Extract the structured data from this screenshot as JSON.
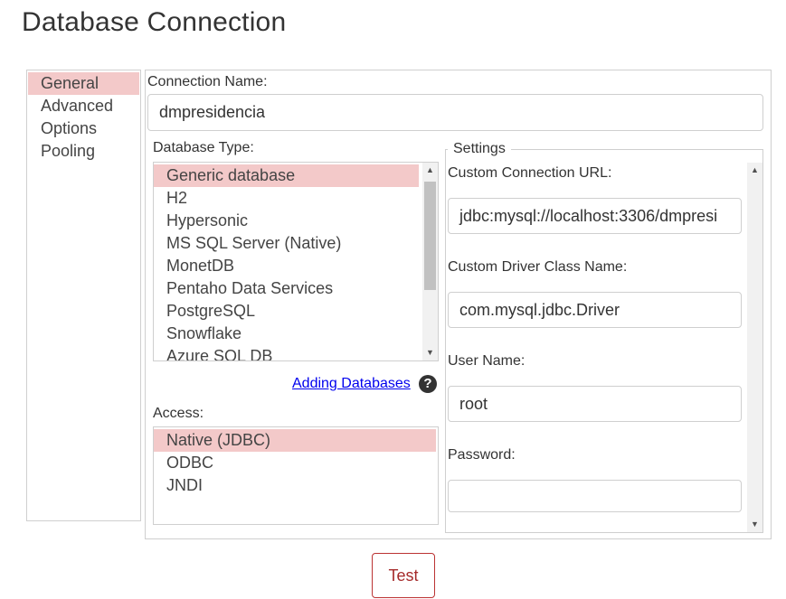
{
  "page": {
    "title": "Database Connection"
  },
  "nav": {
    "items": [
      "General",
      "Advanced",
      "Options",
      "Pooling"
    ],
    "selected": "General"
  },
  "connection": {
    "label": "Connection Name:",
    "value": "dmpresidencia"
  },
  "database_type": {
    "label": "Database Type:",
    "options": [
      "Generic database",
      "H2",
      "Hypersonic",
      "MS SQL Server (Native)",
      "MonetDB",
      "Pentaho Data Services",
      "PostgreSQL",
      "Snowflake",
      "Azure SQL DB"
    ],
    "selected": "Generic database"
  },
  "adding_databases": {
    "label": "Adding Databases",
    "icon": "help-icon"
  },
  "access": {
    "label": "Access:",
    "options": [
      "Native (JDBC)",
      "ODBC",
      "JNDI"
    ],
    "selected": "Native (JDBC)"
  },
  "settings": {
    "legend": "Settings",
    "url_label": "Custom Connection URL:",
    "url_value": "jdbc:mysql://localhost:3306/dmpresi",
    "driver_label": "Custom Driver Class Name:",
    "driver_value": "com.mysql.jdbc.Driver",
    "user_label": "User Name:",
    "user_value": "root",
    "password_label": "Password:",
    "password_value": ""
  },
  "buttons": {
    "test": "Test"
  },
  "colors": {
    "selection": "#f3c9c9",
    "accent": "#a52a2a",
    "link": "#0000ee"
  }
}
